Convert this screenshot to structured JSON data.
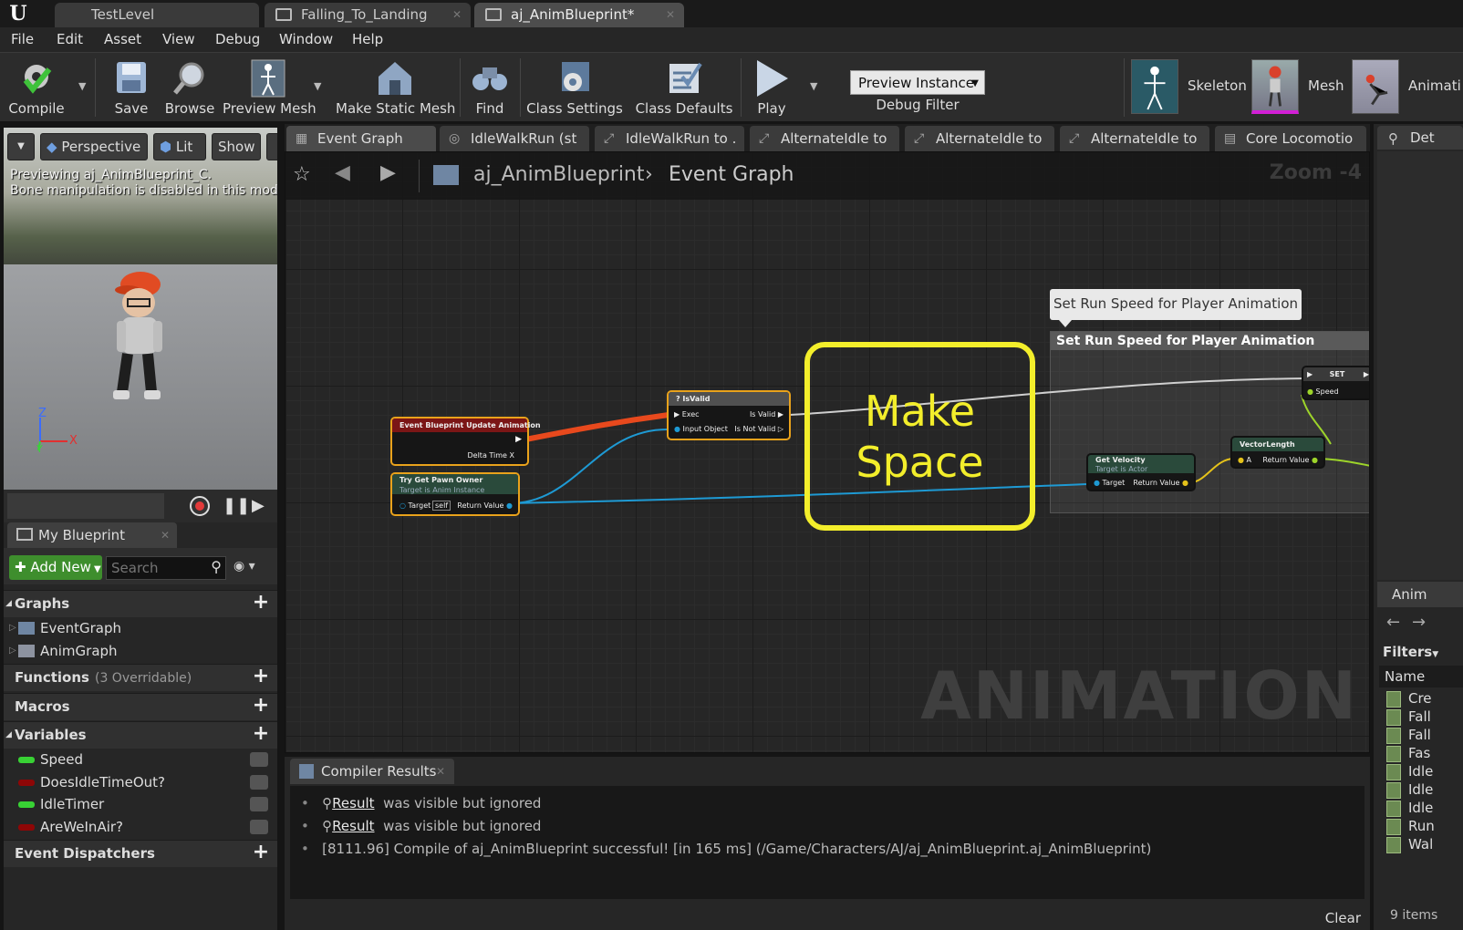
{
  "tabs": [
    {
      "label": "TestLevel"
    },
    {
      "label": "Falling_To_Landing"
    },
    {
      "label": "aj_AnimBlueprint*"
    }
  ],
  "menu": [
    "File",
    "Edit",
    "Asset",
    "View",
    "Debug",
    "Window",
    "Help"
  ],
  "toolbar": {
    "compile": "Compile",
    "save": "Save",
    "browse": "Browse",
    "preview_mesh": "Preview Mesh",
    "make_static_mesh": "Make Static Mesh",
    "find": "Find",
    "class_settings": "Class Settings",
    "class_defaults": "Class Defaults",
    "play": "Play",
    "preview_instance": "Preview Instance",
    "debug_filter": "Debug Filter"
  },
  "modes": {
    "skeleton": "Skeleton",
    "mesh": "Mesh",
    "animation": "Animati"
  },
  "viewport": {
    "perspective": "Perspective",
    "lit": "Lit",
    "show": "Show",
    "line1": "Previewing aj_AnimBlueprint_C.",
    "line2": "Bone manipulation is disabled in this mode.",
    "axis_z": "Z",
    "axis_x": "X",
    "axis_y": "Y"
  },
  "my_blueprint": {
    "tab": "My Blueprint",
    "add_new": "Add New",
    "search_placeholder": "Search",
    "graphs": "Graphs",
    "graph_items": [
      "EventGraph",
      "AnimGraph"
    ],
    "functions": "Functions",
    "functions_sub": "(3 Overridable)",
    "macros": "Macros",
    "variables": "Variables",
    "variable_items": [
      {
        "name": "Speed",
        "color": "#38d134"
      },
      {
        "name": "DoesIdleTimeOut?",
        "color": "#8e0606"
      },
      {
        "name": "IdleTimer",
        "color": "#38d134"
      },
      {
        "name": "AreWeInAir?",
        "color": "#8e0606"
      }
    ],
    "event_dispatchers": "Event Dispatchers"
  },
  "graph_tabs": [
    {
      "label": "Event Graph"
    },
    {
      "label": "IdleWalkRun (st"
    },
    {
      "label": "IdleWalkRun to ."
    },
    {
      "label": "AlternateIdle to"
    },
    {
      "label": "AlternateIdle to"
    },
    {
      "label": "AlternateIdle to"
    },
    {
      "label": "Core Locomotio"
    }
  ],
  "graph": {
    "breadcrumb_root": "aj_AnimBlueprint",
    "breadcrumb_leaf": "Event Graph",
    "zoom": "Zoom -4",
    "comment_bubble": "Set Run Speed for Player Animation",
    "comment_title": "Set Run Speed for Player Animation",
    "annotation_line1": "Make",
    "annotation_line2": "Space",
    "watermark": "ANIMATION",
    "nodes": {
      "event_update": {
        "title": "Event Blueprint Update Animation",
        "pin": "Delta Time X"
      },
      "try_get_pawn": {
        "title": "Try Get Pawn Owner",
        "subtitle": "Target is Anim Instance",
        "target": "Target",
        "self": "self",
        "ret": "Return Value"
      },
      "is_valid": {
        "title": "? IsValid",
        "exec": "Exec",
        "input": "Input Object",
        "valid": "Is Valid",
        "not_valid": "Is Not Valid"
      },
      "get_velocity": {
        "title": "Get Velocity",
        "subtitle": "Target is Actor",
        "target": "Target",
        "ret": "Return Value"
      },
      "vector_length": {
        "title": "VectorLength",
        "a": "A",
        "ret": "Return Value"
      },
      "set": {
        "title": "SET",
        "speed": "Speed"
      }
    }
  },
  "compiler": {
    "tab": "Compiler Results",
    "lines": [
      {
        "link": "Result",
        "text": "was visible but ignored"
      },
      {
        "link": "Result",
        "text": "was visible but ignored"
      },
      {
        "link": "",
        "text": "[8111.96] Compile of aj_AnimBlueprint successful! [in 165 ms] (/Game/Characters/AJ/aj_AnimBlueprint.aj_AnimBlueprint)"
      }
    ],
    "clear": "Clear"
  },
  "right_panel": {
    "details": "Det",
    "anim": "Anim",
    "filters": "Filters",
    "name_col": "Name",
    "assets": [
      "Cre",
      "Fall",
      "Fall",
      "Fas",
      "Idle",
      "Idle",
      "Idle",
      "Run",
      "Wal"
    ],
    "count": "9 items"
  },
  "colors": {
    "exec_wire": "#e8491d",
    "object_wire": "#1e9ad4",
    "float_wire": "#9dd42a",
    "annotation": "#f3ee2b",
    "node_selected_border": "#e9a21b"
  }
}
